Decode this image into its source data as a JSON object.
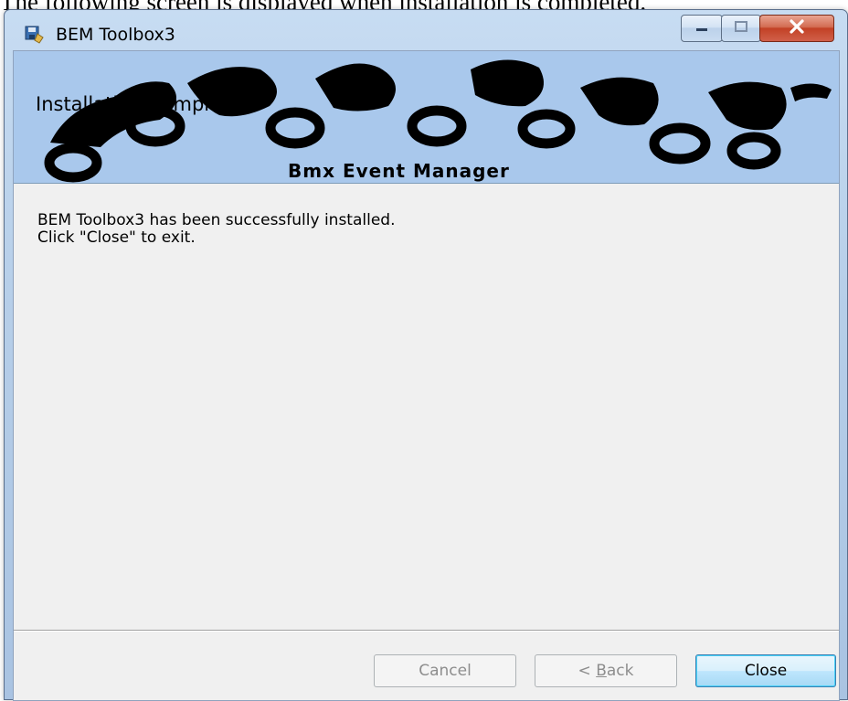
{
  "document": {
    "caption": "The following screen is displayed when installation is completed."
  },
  "window": {
    "title": "BEM Toolbox3",
    "controls": {
      "minimize_icon": "minimize-icon",
      "maximize_icon": "maximize-icon",
      "close_icon": "close-icon"
    }
  },
  "banner": {
    "heading": "Installation Complete",
    "brand": "Bmx Event Manager",
    "background_color": "#a9c8ec"
  },
  "message": {
    "line1": "BEM Toolbox3 has been successfully installed.",
    "line2": "Click \"Close\" to exit."
  },
  "buttons": {
    "cancel": "Cancel",
    "back_prefix": "< ",
    "back_mnemonic": "B",
    "back_rest": "ack",
    "close": "Close"
  }
}
